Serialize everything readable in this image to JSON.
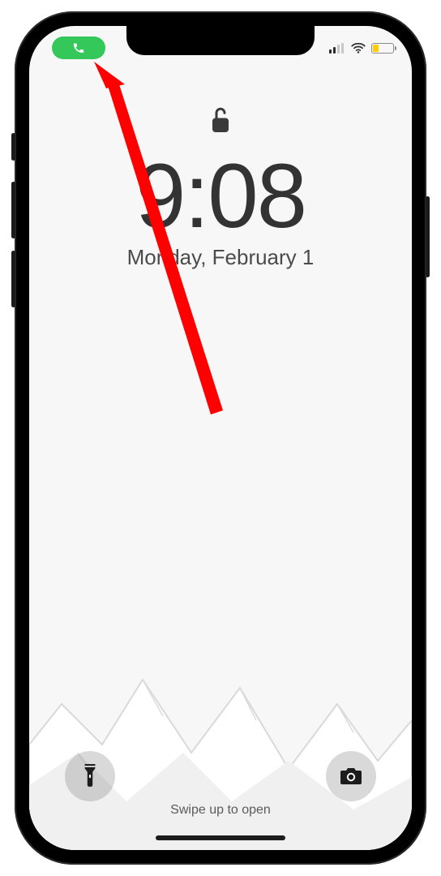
{
  "status": {
    "call_pill_icon": "phone-icon",
    "call_pill_color": "#34c759",
    "signal_bars": 2,
    "wifi_on": true,
    "battery_level_pct": 28,
    "battery_low_color": "#ffcc00"
  },
  "lockscreen": {
    "lock_state": "unlocked",
    "time": "9:08",
    "date": "Monday, February 1",
    "swipe_hint": "Swipe up to open"
  },
  "controls": {
    "flashlight_icon": "flashlight-icon",
    "camera_icon": "camera-icon"
  },
  "annotation": {
    "type": "arrow",
    "target": "call-indicator-pill",
    "color": "#ff0000"
  }
}
